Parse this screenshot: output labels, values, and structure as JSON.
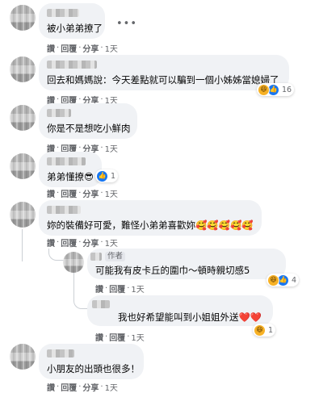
{
  "comments": [
    {
      "text": "被小弟弟撩了",
      "more_icon": "more-dots-icon"
    },
    {
      "text": "回去和媽媽說：今天差點就可以騙到一個小姊姊當媳婦了",
      "reaction_count": "16"
    },
    {
      "text": "你是不是想吃小鮮肉"
    },
    {
      "text": "弟弟懂撩😎",
      "reaction_count": "1"
    },
    {
      "text": "妳的裝備好可愛，難怪小弟弟喜歡妳🥰🥰🥰🥰🥰"
    },
    {
      "text": "可能我有皮卡丘的圍巾～頓時親切感5",
      "author_badge": "作者",
      "reaction_count": "4"
    },
    {
      "text": "我也好希望能叫到小姐姐外送❤️❤️",
      "reaction_count": "1"
    },
    {
      "text": "小朋友的出頭也很多！"
    }
  ],
  "actions": {
    "like": "讚",
    "reply": "回覆",
    "share": "分享",
    "separator": "·",
    "time": "1天"
  },
  "icons": {
    "haha": "haha-reaction-icon",
    "like": "like-reaction-icon",
    "more": "more-dots-icon"
  }
}
